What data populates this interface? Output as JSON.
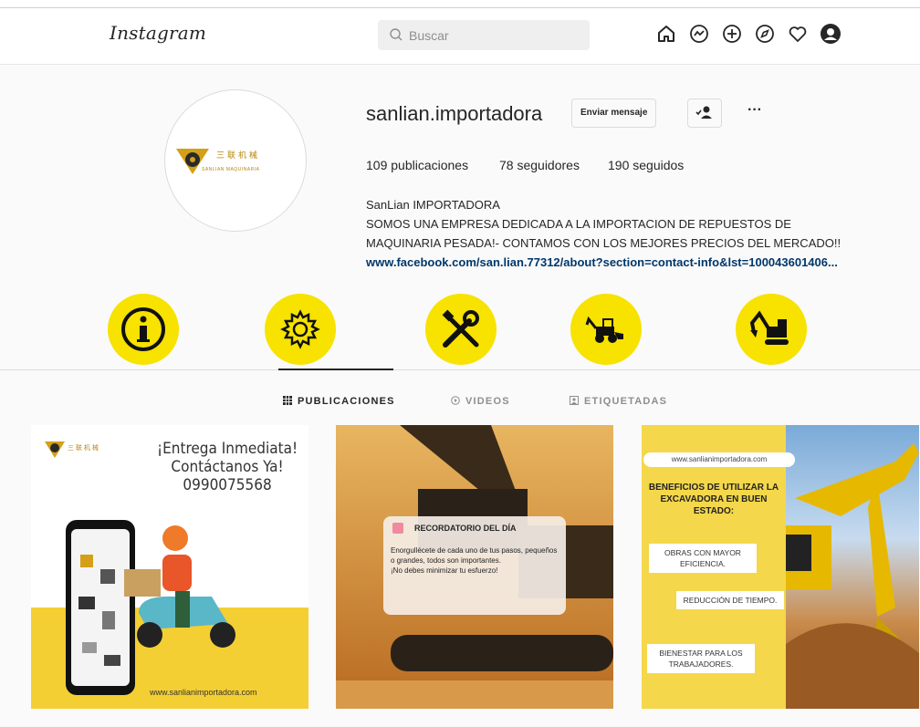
{
  "header": {
    "logo": "Instagram",
    "search_placeholder": "Buscar"
  },
  "nav_icons": [
    "home-icon",
    "messenger-icon",
    "new-post-icon",
    "explore-icon",
    "activity-icon",
    "profile-icon"
  ],
  "profile": {
    "username": "sanlian.importadora",
    "message_button": "Enviar mensaje",
    "more_button": "···",
    "avatar_logo_text": "三联机械",
    "avatar_logo_subtext": "SANLIAN MAQUINARIA",
    "stats": {
      "posts": "109 publicaciones",
      "followers": "78 seguidores",
      "following": "190 seguidos"
    },
    "bio": {
      "name": "SanLian IMPORTADORA",
      "line1": "SOMOS UNA EMPRESA DEDICADA A LA IMPORTACION DE REPUESTOS DE",
      "line2": "MAQUINARIA PESADA!- CONTAMOS CON LOS MEJORES PRECIOS DEL MERCADO!!",
      "link": "www.facebook.com/san.lian.77312/about?section=contact-info&lst=100043601406..."
    }
  },
  "highlights": [
    "info-icon",
    "gear-icon",
    "tools-icon",
    "backhoe-icon",
    "excavator-icon"
  ],
  "highlight_color": "#f7e200",
  "tabs": [
    {
      "label": "PUBLICACIONES",
      "icon": "grid-icon",
      "active": true
    },
    {
      "label": "VIDEOS",
      "icon": "video-icon",
      "active": false
    },
    {
      "label": "ETIQUETADAS",
      "icon": "tag-icon",
      "active": false
    }
  ],
  "posts": [
    {
      "logo_text": "三 联 机 械",
      "headline_1": "¡Entrega Inmediata!",
      "headline_2": "Contáctanos Ya!",
      "headline_3": "0990075568",
      "url": "www.sanlianimportadora.com"
    },
    {
      "card_title": "RECORDATORIO DEL DÍA",
      "card_body_1": "Enorgullécete de cada uno de tus pasos, pequeños o grandes, todos son importantes.",
      "card_body_2": "¡No debes minimizar tu esfuerzo!"
    },
    {
      "url": "www.sanlianimportadora.com",
      "title": "BENEFICIOS DE UTILIZAR LA EXCAVADORA EN BUEN ESTADO:",
      "benefit_1": "OBRAS CON MAYOR EFICIENCIA.",
      "benefit_2": "REDUCCIÓN DE TIEMPO.",
      "benefit_3": "BIENESTAR PARA LOS TRABAJADORES."
    }
  ]
}
